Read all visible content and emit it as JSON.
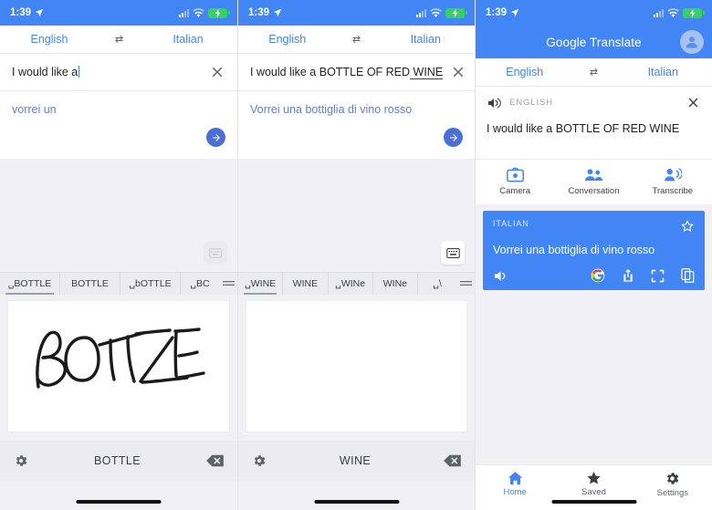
{
  "status_bar": {
    "time": "1:39",
    "icons": [
      "location-arrow-icon",
      "signal-bars-icon",
      "wifi-icon",
      "battery-charging-icon"
    ]
  },
  "colors": {
    "brand_blue": "#4285f4",
    "card_blue": "#4285f4",
    "link_blue": "#5c7fe0",
    "background_gray": "#f0f0f5",
    "keyboard_gray": "#ebebf0"
  },
  "panel1": {
    "lang_from": "English",
    "lang_to": "Italian",
    "swap_icon": "swap-horizontal-icon",
    "input_value": "I would like a",
    "clear_icon": "close-icon",
    "translation_preview": "vorrei un",
    "go_icon": "arrow-forward-icon",
    "keyboard_toggle_icon": "keyboard-icon",
    "suggestions": [
      "␣BOTTLE",
      "BOTTLE",
      "␣bOTTLE",
      "␣BC"
    ],
    "suggestions_more_icon": "more-suggestions-icon",
    "handwriting_text": "BOTTLE",
    "keyboard_settings_icon": "gear-icon",
    "keyboard_word": "BOTTLE",
    "keyboard_backspace_icon": "backspace-icon"
  },
  "panel2": {
    "lang_from": "English",
    "lang_to": "Italian",
    "swap_icon": "swap-horizontal-icon",
    "input_value": "I would like a BOTTLE OF RED",
    "input_composing": " WINE",
    "clear_icon": "close-icon",
    "translation_preview": "Vorrei una bottiglia di vino rosso",
    "go_icon": "arrow-forward-icon",
    "keyboard_toggle_icon": "keyboard-icon",
    "suggestions": [
      "␣WINE",
      "WINE",
      "␣WINe",
      "WINe",
      "␣\\"
    ],
    "suggestions_more_icon": "more-suggestions-icon",
    "handwriting_text": "",
    "keyboard_settings_icon": "gear-icon",
    "keyboard_word": "WINE",
    "keyboard_backspace_icon": "backspace-icon"
  },
  "panel3": {
    "app_title": "Google Translate",
    "avatar_icon": "account-circle-icon",
    "lang_from": "English",
    "lang_to": "Italian",
    "swap_icon": "swap-horizontal-icon",
    "source_lang_label": "ENGLISH",
    "speaker_icon": "volume-up-icon",
    "close_icon": "close-icon",
    "source_text": "I would like a BOTTLE OF RED WINE",
    "actions": [
      {
        "label": "Camera",
        "icon": "camera-icon"
      },
      {
        "label": "Conversation",
        "icon": "conversation-icon"
      },
      {
        "label": "Transcribe",
        "icon": "transcribe-icon"
      }
    ],
    "card": {
      "lang_label": "ITALIAN",
      "star_icon": "star-outline-icon",
      "text": "Vorrei una bottiglia di vino rosso",
      "icons": [
        "volume-up-icon",
        "google-search-icon",
        "share-icon",
        "fullscreen-icon",
        "copy-icon"
      ]
    },
    "nav": [
      {
        "label": "Home",
        "icon": "home-icon",
        "active": true
      },
      {
        "label": "Saved",
        "icon": "star-icon",
        "active": false
      },
      {
        "label": "Settings",
        "icon": "gear-icon",
        "active": false
      }
    ]
  }
}
